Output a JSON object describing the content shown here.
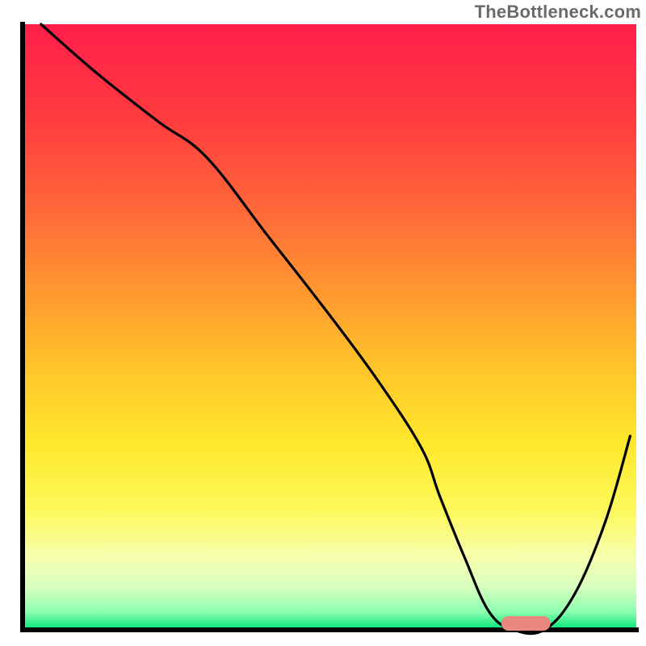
{
  "watermark": "TheBottleneck.com",
  "chart_data": {
    "type": "line",
    "title": "",
    "xlabel": "",
    "ylabel": "",
    "xlim": [
      0,
      100
    ],
    "ylim": [
      0,
      100
    ],
    "x": [
      3,
      12,
      22,
      30,
      40,
      50,
      58,
      65,
      68,
      72,
      76,
      80,
      85,
      90,
      95,
      99
    ],
    "values": [
      100,
      92,
      84,
      78,
      65,
      52,
      41,
      30,
      22,
      12,
      3,
      0,
      0,
      6,
      18,
      32
    ],
    "marker": {
      "x_start": 78,
      "x_end": 86,
      "y": 0,
      "thickness": 1.6,
      "color": "#e9887f"
    },
    "gradient_stops": [
      {
        "offset": 0.0,
        "color": "#ff1f4a"
      },
      {
        "offset": 0.15,
        "color": "#ff3a3f"
      },
      {
        "offset": 0.3,
        "color": "#ff663a"
      },
      {
        "offset": 0.45,
        "color": "#ff9a2f"
      },
      {
        "offset": 0.58,
        "color": "#ffc92a"
      },
      {
        "offset": 0.7,
        "color": "#ffe92e"
      },
      {
        "offset": 0.8,
        "color": "#fdf85a"
      },
      {
        "offset": 0.88,
        "color": "#f7ffae"
      },
      {
        "offset": 0.93,
        "color": "#d6ffbf"
      },
      {
        "offset": 0.97,
        "color": "#8dffb0"
      },
      {
        "offset": 1.0,
        "color": "#00e676"
      }
    ],
    "axis_color": "#000000",
    "line_color": "#000000"
  }
}
